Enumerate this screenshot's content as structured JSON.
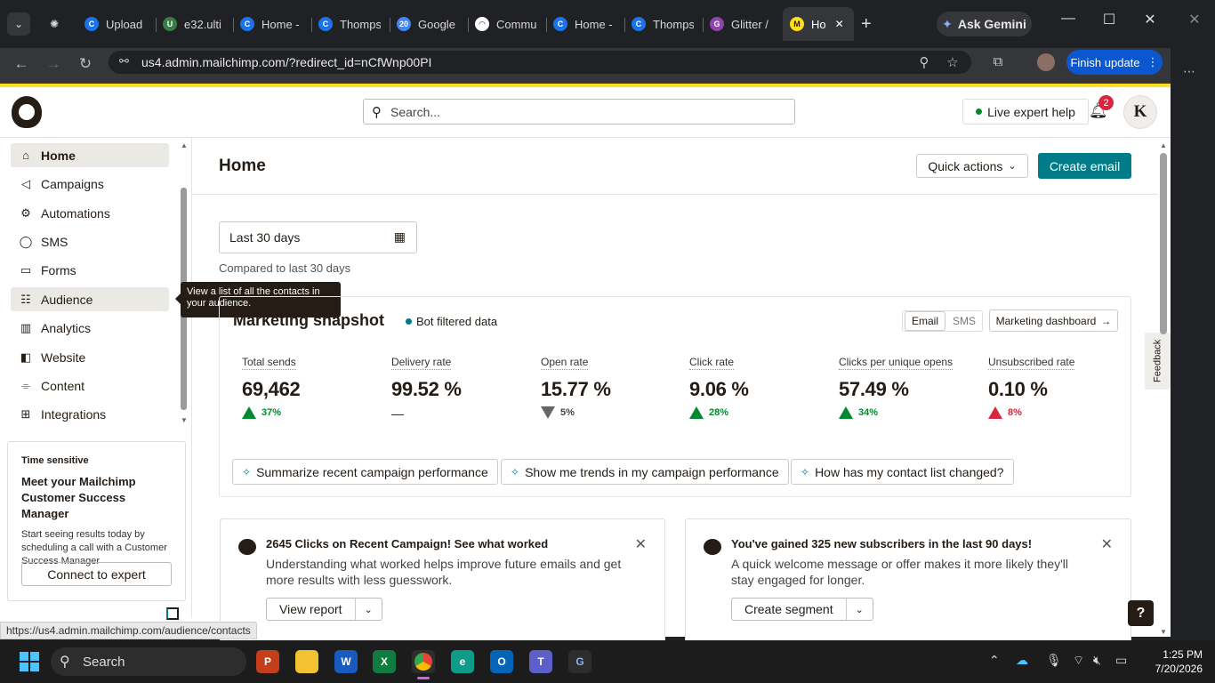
{
  "browser": {
    "tabs": [
      {
        "label": "Upload",
        "color": "#1a73e8",
        "glyph": "C"
      },
      {
        "label": "e32.ulti",
        "color": "#3a7d44",
        "glyph": "U"
      },
      {
        "label": "Home -",
        "color": "#1a73e8",
        "glyph": "C"
      },
      {
        "label": "Thomps",
        "color": "#1a73e8",
        "glyph": "C"
      },
      {
        "label": "Google",
        "color": "#4285f4",
        "glyph": "20"
      },
      {
        "label": "Commu",
        "color": "#ffffff",
        "glyph": "◠"
      },
      {
        "label": "Home -",
        "color": "#1a73e8",
        "glyph": "C"
      },
      {
        "label": "Thomps",
        "color": "#1a73e8",
        "glyph": "C"
      },
      {
        "label": "Glitter /",
        "color": "#8e44ad",
        "glyph": "G"
      },
      {
        "label": "Ho",
        "color": "#ffe01b",
        "glyph": "M"
      }
    ],
    "new_tab": "+",
    "gemini_label": "Ask Gemini",
    "url": "us4.admin.mailchimp.com/?redirect_id=nCfWnp00PI",
    "finish_update": "Finish update",
    "status_url": "https://us4.admin.mailchimp.com/audience/contacts"
  },
  "header": {
    "search_placeholder": "Search...",
    "live_help": "Live expert help",
    "notification_count": "2",
    "avatar_initial": "K"
  },
  "sidebar": {
    "items": [
      {
        "label": "Home",
        "icon": "home-icon",
        "glyph": "⌂"
      },
      {
        "label": "Campaigns",
        "icon": "megaphone-icon",
        "glyph": "◁"
      },
      {
        "label": "Automations",
        "icon": "automation-icon",
        "glyph": "⚙"
      },
      {
        "label": "SMS",
        "icon": "sms-icon",
        "glyph": "◯"
      },
      {
        "label": "Forms",
        "icon": "forms-icon",
        "glyph": "▭"
      },
      {
        "label": "Audience",
        "icon": "audience-icon",
        "glyph": "☷"
      },
      {
        "label": "Analytics",
        "icon": "analytics-icon",
        "glyph": "▥"
      },
      {
        "label": "Website",
        "icon": "website-icon",
        "glyph": "◧"
      },
      {
        "label": "Content",
        "icon": "content-icon",
        "glyph": "⌯"
      },
      {
        "label": "Integrations",
        "icon": "integrations-icon",
        "glyph": "⊞"
      }
    ],
    "tooltip": "View a list of all the contacts in your audience.",
    "csm": {
      "tag": "Time sensitive",
      "title": "Meet your Mailchimp Customer Success Manager",
      "desc": "Start seeing results today by scheduling a call with a Customer Success Manager",
      "button": "Connect to expert"
    }
  },
  "main": {
    "title": "Home",
    "quick_actions": "Quick actions",
    "create_email": "Create email",
    "date_range": "Last 30 days",
    "compared": "Compared to last 30 days",
    "snapshot": {
      "title": "Marketing snapshot",
      "bot_filtered": "Bot filtered data",
      "toggle_email": "Email",
      "toggle_sms": "SMS",
      "dashboard_link": "Marketing dashboard",
      "metrics": [
        {
          "label": "Total sends",
          "value": "69,462",
          "change": "37%",
          "trend": "up",
          "color": "#00892e"
        },
        {
          "label": "Delivery rate",
          "value": "99.52 %",
          "change": "—",
          "trend": "none",
          "color": "#241c15"
        },
        {
          "label": "Open rate",
          "value": "15.77 %",
          "change": "5%",
          "trend": "down",
          "color": "#444444"
        },
        {
          "label": "Click rate",
          "value": "9.06 %",
          "change": "28%",
          "trend": "up",
          "color": "#00892e"
        },
        {
          "label": "Clicks per unique opens",
          "value": "57.49 %",
          "change": "34%",
          "trend": "up",
          "color": "#00892e"
        },
        {
          "label": "Unsubscribed rate",
          "value": "0.10 %",
          "change": "8%",
          "trend": "up-bad",
          "color": "#d7263d"
        }
      ],
      "suggestions": [
        "Summarize recent campaign performance",
        "Show me trends in my campaign performance",
        "How has my contact list changed?"
      ]
    },
    "cards": [
      {
        "title": "2645 Clicks on Recent Campaign! See what worked",
        "desc": "Understanding what worked helps improve future emails and get more results with less guesswork.",
        "button": "View report"
      },
      {
        "title": "You've gained 325 new subscribers in the last 90 days!",
        "desc": "A quick welcome message or offer makes it more likely they'll stay engaged for longer.",
        "button": "Create segment"
      }
    ],
    "feedback": "Feedback",
    "help": "?"
  },
  "taskbar": {
    "search": "Search",
    "time": "1:25 PM",
    "date": "7/20/2026"
  }
}
